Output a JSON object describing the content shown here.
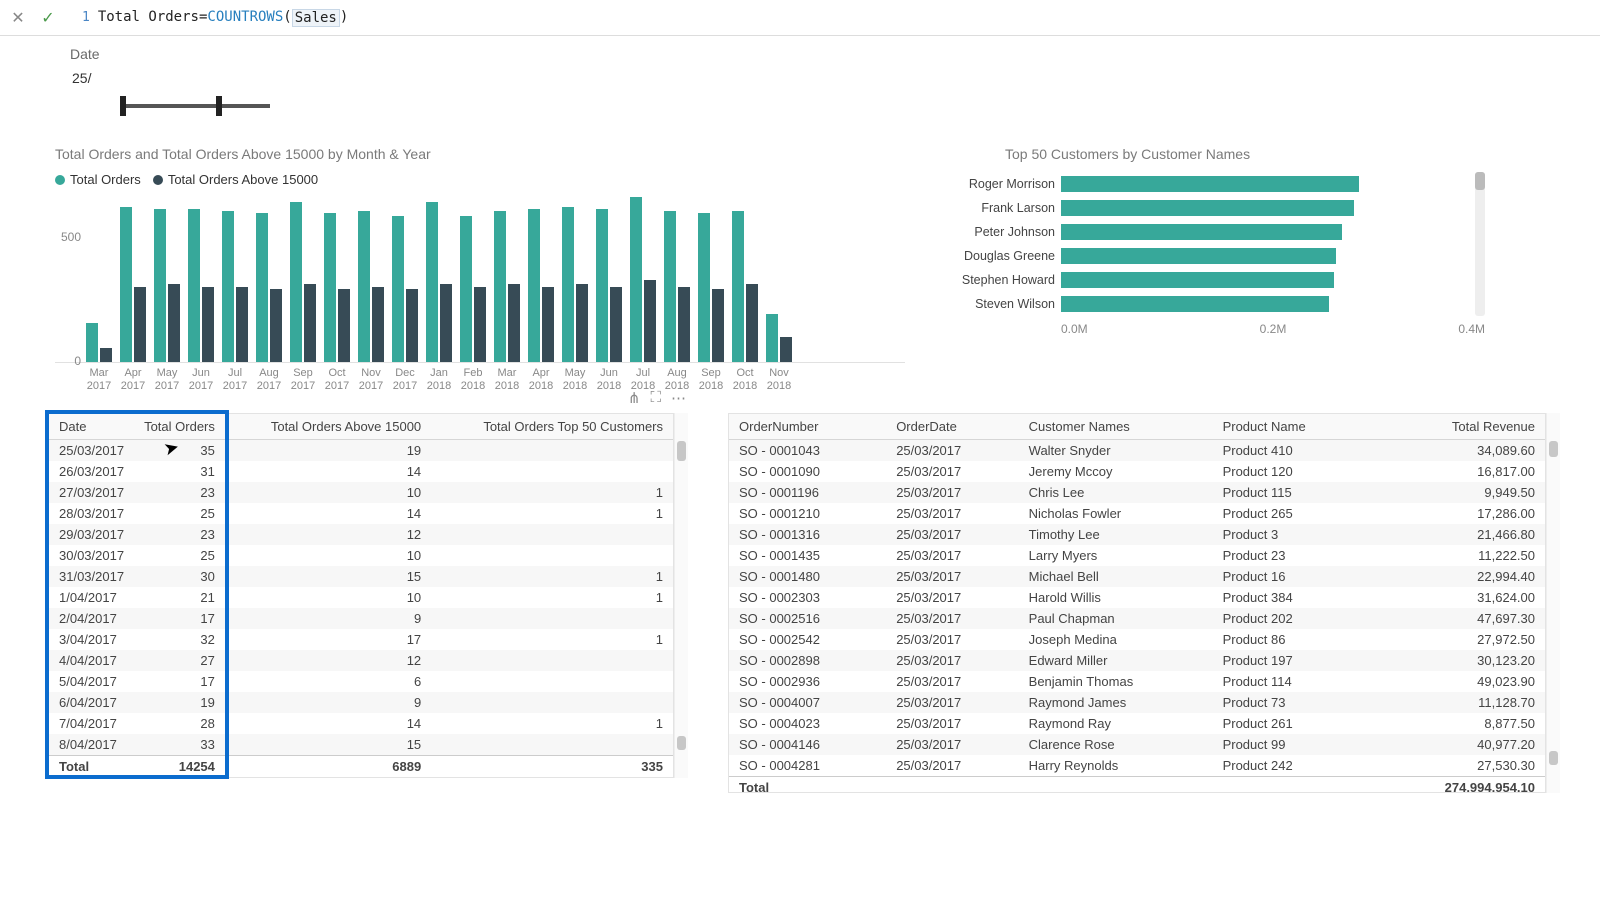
{
  "formula_bar": {
    "line_no": "1",
    "measure_name": "Total Orders",
    "eq": " = ",
    "func": "COUNTROWS",
    "open": "( ",
    "arg": "Sales",
    "close": " )"
  },
  "slicer": {
    "label": "Date",
    "value": "25/"
  },
  "chart_data": [
    {
      "type": "bar",
      "title": "Total Orders and Total Orders Above 15000 by Month & Year",
      "ylabel": "",
      "ylim": [
        0,
        700
      ],
      "yticks": [
        "500",
        "0"
      ],
      "legend": [
        {
          "name": "Total Orders",
          "color": "#37a89a"
        },
        {
          "name": "Total Orders Above 15000",
          "color": "#374b56"
        }
      ],
      "categories": [
        "Mar 2017",
        "Apr 2017",
        "May 2017",
        "Jun 2017",
        "Jul 2017",
        "Aug 2017",
        "Sep 2017",
        "Oct 2017",
        "Nov 2017",
        "Dec 2017",
        "Jan 2018",
        "Feb 2018",
        "Mar 2018",
        "Apr 2018",
        "May 2018",
        "Jun 2018",
        "Jul 2018",
        "Aug 2018",
        "Sep 2018",
        "Oct 2018",
        "Nov 2018"
      ],
      "series": [
        {
          "name": "Total Orders",
          "values": [
            170,
            680,
            670,
            670,
            660,
            650,
            700,
            650,
            660,
            640,
            700,
            640,
            660,
            670,
            680,
            670,
            720,
            660,
            650,
            660,
            210
          ]
        },
        {
          "name": "Total Orders Above 15000",
          "values": [
            60,
            330,
            340,
            330,
            330,
            320,
            340,
            320,
            330,
            320,
            340,
            330,
            340,
            330,
            340,
            330,
            360,
            330,
            320,
            340,
            110
          ]
        }
      ]
    },
    {
      "type": "bar",
      "orientation": "horizontal",
      "title": "Top 50 Customers by Customer Names",
      "xlim": [
        0,
        0.4
      ],
      "xticks": [
        "0.0M",
        "0.2M",
        "0.4M"
      ],
      "categories": [
        "Roger Morrison",
        "Frank Larson",
        "Peter Johnson",
        "Douglas Greene",
        "Stephen Howard",
        "Steven Wilson"
      ],
      "values": [
        0.295,
        0.29,
        0.278,
        0.272,
        0.27,
        0.265
      ]
    }
  ],
  "left_table": {
    "headers": [
      "Date",
      "Total Orders",
      "Total Orders Above 15000",
      "Total Orders Top 50 Customers"
    ],
    "rows": [
      {
        "date": "25/03/2017",
        "a": "35",
        "b": "19",
        "c": ""
      },
      {
        "date": "26/03/2017",
        "a": "31",
        "b": "14",
        "c": ""
      },
      {
        "date": "27/03/2017",
        "a": "23",
        "b": "10",
        "c": "1"
      },
      {
        "date": "28/03/2017",
        "a": "25",
        "b": "14",
        "c": "1"
      },
      {
        "date": "29/03/2017",
        "a": "23",
        "b": "12",
        "c": ""
      },
      {
        "date": "30/03/2017",
        "a": "25",
        "b": "10",
        "c": ""
      },
      {
        "date": "31/03/2017",
        "a": "30",
        "b": "15",
        "c": "1"
      },
      {
        "date": "1/04/2017",
        "a": "21",
        "b": "10",
        "c": "1"
      },
      {
        "date": "2/04/2017",
        "a": "17",
        "b": "9",
        "c": ""
      },
      {
        "date": "3/04/2017",
        "a": "32",
        "b": "17",
        "c": "1"
      },
      {
        "date": "4/04/2017",
        "a": "27",
        "b": "12",
        "c": ""
      },
      {
        "date": "5/04/2017",
        "a": "17",
        "b": "6",
        "c": ""
      },
      {
        "date": "6/04/2017",
        "a": "19",
        "b": "9",
        "c": ""
      },
      {
        "date": "7/04/2017",
        "a": "28",
        "b": "14",
        "c": "1"
      },
      {
        "date": "8/04/2017",
        "a": "33",
        "b": "15",
        "c": ""
      }
    ],
    "footer": {
      "label": "Total",
      "a": "14254",
      "b": "6889",
      "c": "335"
    }
  },
  "right_table": {
    "headers": [
      "OrderNumber",
      "OrderDate",
      "Customer Names",
      "Product Name",
      "Total Revenue"
    ],
    "rows": [
      {
        "o": "SO - 0001043",
        "d": "25/03/2017",
        "c": "Walter Snyder",
        "p": "Product 410",
        "r": "34,089.60"
      },
      {
        "o": "SO - 0001090",
        "d": "25/03/2017",
        "c": "Jeremy Mccoy",
        "p": "Product 120",
        "r": "16,817.00"
      },
      {
        "o": "SO - 0001196",
        "d": "25/03/2017",
        "c": "Chris Lee",
        "p": "Product 115",
        "r": "9,949.50"
      },
      {
        "o": "SO - 0001210",
        "d": "25/03/2017",
        "c": "Nicholas Fowler",
        "p": "Product 265",
        "r": "17,286.00"
      },
      {
        "o": "SO - 0001316",
        "d": "25/03/2017",
        "c": "Timothy Lee",
        "p": "Product 3",
        "r": "21,466.80"
      },
      {
        "o": "SO - 0001435",
        "d": "25/03/2017",
        "c": "Larry Myers",
        "p": "Product 23",
        "r": "11,222.50"
      },
      {
        "o": "SO - 0001480",
        "d": "25/03/2017",
        "c": "Michael Bell",
        "p": "Product 16",
        "r": "22,994.40"
      },
      {
        "o": "SO - 0002303",
        "d": "25/03/2017",
        "c": "Harold Willis",
        "p": "Product 384",
        "r": "31,624.00"
      },
      {
        "o": "SO - 0002516",
        "d": "25/03/2017",
        "c": "Paul Chapman",
        "p": "Product 202",
        "r": "47,697.30"
      },
      {
        "o": "SO - 0002542",
        "d": "25/03/2017",
        "c": "Joseph Medina",
        "p": "Product 86",
        "r": "27,972.50"
      },
      {
        "o": "SO - 0002898",
        "d": "25/03/2017",
        "c": "Edward Miller",
        "p": "Product 197",
        "r": "30,123.20"
      },
      {
        "o": "SO - 0002936",
        "d": "25/03/2017",
        "c": "Benjamin Thomas",
        "p": "Product 114",
        "r": "49,023.90"
      },
      {
        "o": "SO - 0004007",
        "d": "25/03/2017",
        "c": "Raymond James",
        "p": "Product 73",
        "r": "11,128.70"
      },
      {
        "o": "SO - 0004023",
        "d": "25/03/2017",
        "c": "Raymond Ray",
        "p": "Product 261",
        "r": "8,877.50"
      },
      {
        "o": "SO - 0004146",
        "d": "25/03/2017",
        "c": "Clarence Rose",
        "p": "Product 99",
        "r": "40,977.20"
      },
      {
        "o": "SO - 0004281",
        "d": "25/03/2017",
        "c": "Harry Reynolds",
        "p": "Product 242",
        "r": "27,530.30"
      }
    ],
    "footer": {
      "label": "Total",
      "total": "274,994,954.10"
    }
  },
  "toolbar_icons": {
    "filter": "⋔",
    "focus": "⛶",
    "more": "⋯"
  },
  "colors": {
    "accent": "#37a89a",
    "dark": "#374b56",
    "highlight": "#0b6cce"
  }
}
